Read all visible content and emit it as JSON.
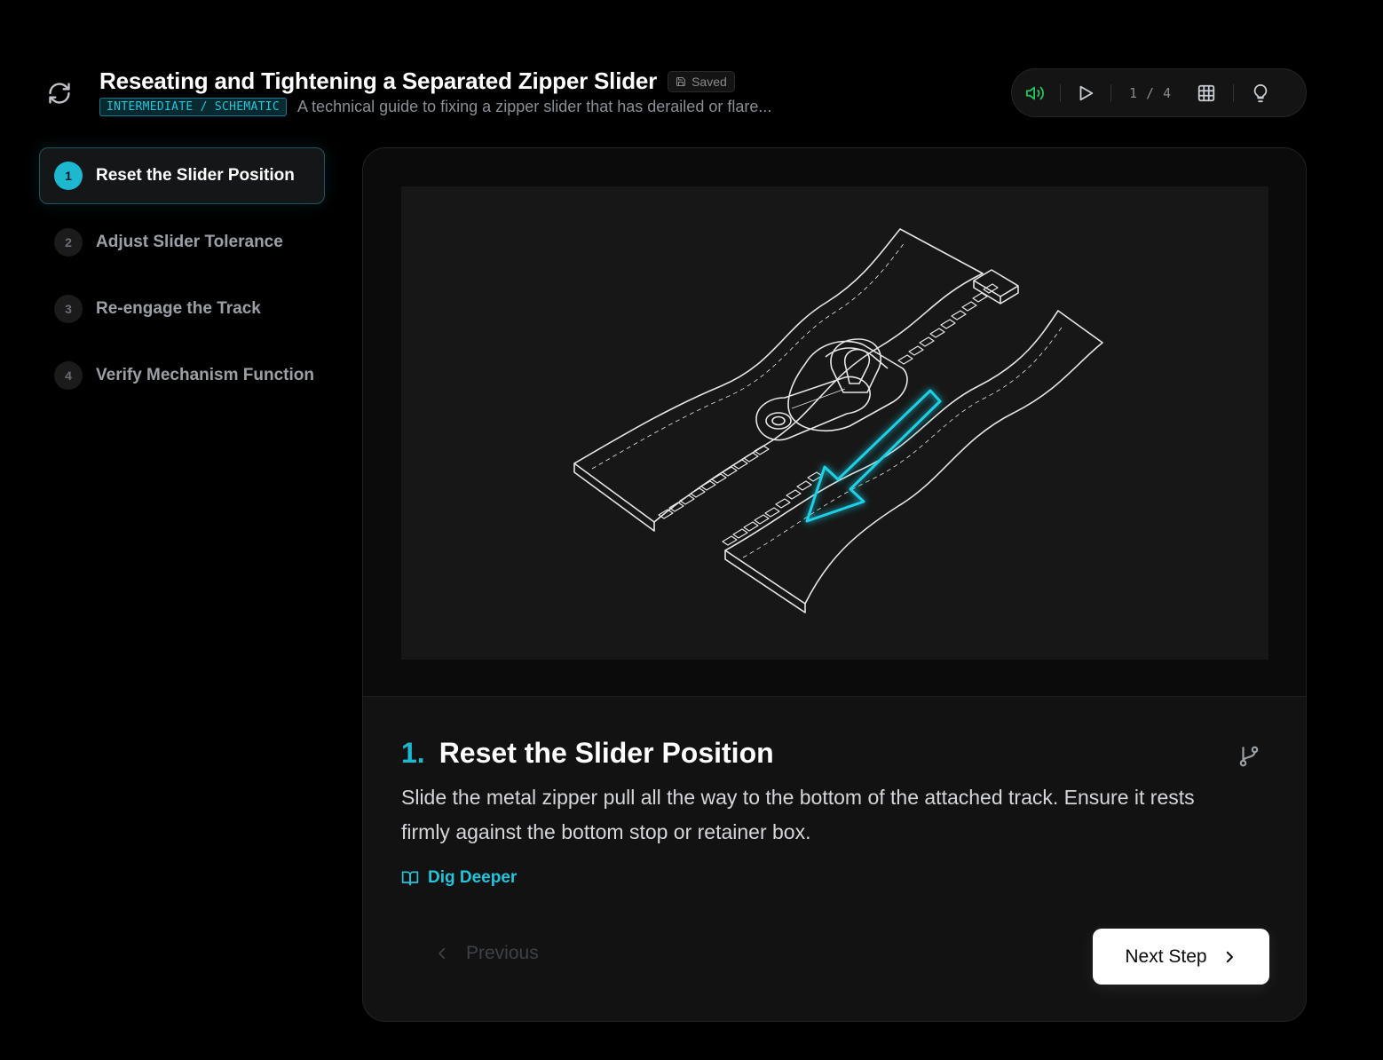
{
  "header": {
    "title": "Reseating and Tightening a Separated Zipper Slider",
    "saved_label": "Saved",
    "level_badge": "INTERMEDIATE / SCHEMATIC",
    "subtitle": "A technical guide to fixing a zipper slider that has derailed or flare..."
  },
  "toolbar": {
    "current_step": "1",
    "separator": "/",
    "total_steps": "4"
  },
  "sidebar": {
    "items": [
      {
        "number": "1",
        "label": "Reset the Slider Position"
      },
      {
        "number": "2",
        "label": "Adjust Slider Tolerance"
      },
      {
        "number": "3",
        "label": "Re-engage the Track"
      },
      {
        "number": "4",
        "label": "Verify Mechanism Function"
      }
    ]
  },
  "step": {
    "number": "1.",
    "title": "Reset the Slider Position",
    "description": "Slide the metal zipper pull all the way to the bottom of the attached track. Ensure it rests firmly against the bottom stop or retainer box.",
    "dig_deeper_label": "Dig Deeper"
  },
  "navigation": {
    "previous_label": "Previous",
    "next_label": "Next Step"
  },
  "colors": {
    "accent": "#1bb8d0",
    "volume_icon": "#22c55e",
    "background": "#000000",
    "card": "#121212"
  },
  "icons": [
    "refresh-icon",
    "save-icon",
    "volume-icon",
    "play-icon",
    "grid-icon",
    "lightbulb-icon",
    "git-branch-icon",
    "book-icon",
    "chevron-left-icon",
    "chevron-right-icon"
  ]
}
